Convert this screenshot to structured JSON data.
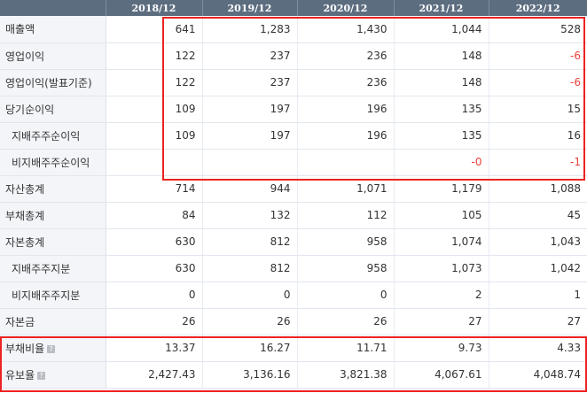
{
  "table": {
    "columns": [
      "2018/12",
      "2019/12",
      "2020/12",
      "2021/12",
      "2022/12"
    ],
    "rows": [
      {
        "label": "매출액",
        "values": [
          "641",
          "1,283",
          "1,430",
          "1,044",
          "528"
        ]
      },
      {
        "label": "영업이익",
        "values": [
          "122",
          "237",
          "236",
          "148",
          "-6"
        ]
      },
      {
        "label": "영업이익(발표기준)",
        "values": [
          "122",
          "237",
          "236",
          "148",
          "-6"
        ]
      },
      {
        "label": "당기순이익",
        "values": [
          "109",
          "197",
          "196",
          "135",
          "15"
        ]
      },
      {
        "label": "지배주주순이익",
        "values": [
          "109",
          "197",
          "196",
          "135",
          "16"
        ]
      },
      {
        "label": "비지배주주순이익",
        "values": [
          "",
          "",
          "",
          "-0",
          "-1"
        ]
      },
      {
        "label": "자산총계",
        "values": [
          "714",
          "944",
          "1,071",
          "1,179",
          "1,088"
        ]
      },
      {
        "label": "부채총계",
        "values": [
          "84",
          "132",
          "112",
          "105",
          "45"
        ]
      },
      {
        "label": "자본총계",
        "values": [
          "630",
          "812",
          "958",
          "1,074",
          "1,043"
        ]
      },
      {
        "label": "지배주주지분",
        "values": [
          "630",
          "812",
          "958",
          "1,073",
          "1,042"
        ]
      },
      {
        "label": "비지배주주지분",
        "values": [
          "0",
          "0",
          "0",
          "2",
          "1"
        ]
      },
      {
        "label": "자본금",
        "values": [
          "26",
          "26",
          "26",
          "27",
          "27"
        ]
      },
      {
        "label": "부채비율",
        "values": [
          "13.37",
          "16.27",
          "11.71",
          "9.73",
          "4.33"
        ]
      },
      {
        "label": "유보율",
        "values": [
          "2,427.43",
          "3,136.16",
          "3,821.38",
          "4,067.61",
          "4,048.74"
        ]
      }
    ]
  },
  "help_icon": {
    "glyph": "?",
    "name": "help-icon"
  },
  "colors": {
    "header_bg": "#5d6d80",
    "label_bg": "#f3f5f9",
    "negative": "#e8423a",
    "highlight": "#ee2222"
  }
}
